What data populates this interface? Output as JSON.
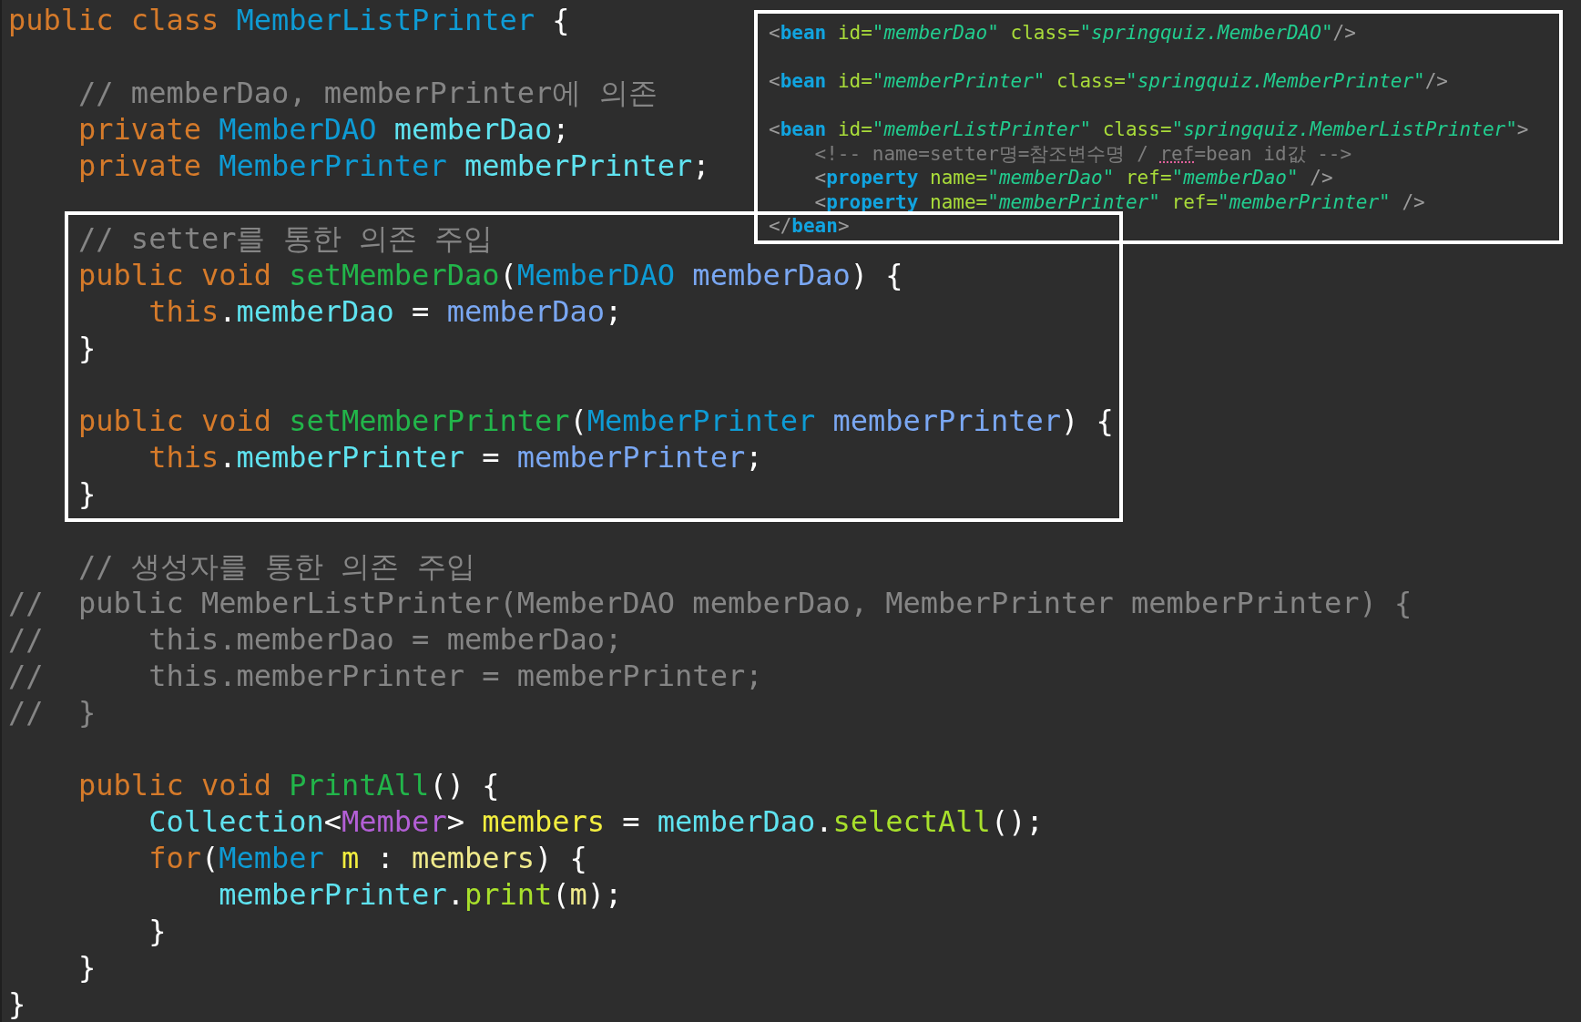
{
  "code_lines": [
    {
      "kind": "code",
      "tokens": [
        {
          "text": "public class ",
          "kind": "keyword"
        },
        {
          "text": "MemberListPrinter",
          "kind": "type"
        },
        {
          "text": " {",
          "kind": "plain"
        }
      ]
    },
    {
      "kind": "blank"
    },
    {
      "kind": "code",
      "tokens": [
        {
          "text": "    // memberDao, memberPrinter에 의존",
          "kind": "comment"
        }
      ]
    },
    {
      "kind": "code",
      "tokens": [
        {
          "text": "    private ",
          "kind": "keyword"
        },
        {
          "text": "MemberDAO ",
          "kind": "type"
        },
        {
          "text": "memberDao",
          "kind": "field"
        },
        {
          "text": ";",
          "kind": "plain"
        }
      ]
    },
    {
      "kind": "code",
      "tokens": [
        {
          "text": "    private ",
          "kind": "keyword"
        },
        {
          "text": "MemberPrinter ",
          "kind": "type"
        },
        {
          "text": "memberPrinter",
          "kind": "field"
        },
        {
          "text": ";",
          "kind": "plain"
        }
      ]
    },
    {
      "kind": "blank"
    },
    {
      "kind": "code",
      "tokens": [
        {
          "text": "    // setter를 통한 의존 주입",
          "kind": "comment"
        }
      ]
    },
    {
      "kind": "code",
      "tokens": [
        {
          "text": "    public void ",
          "kind": "keyword"
        },
        {
          "text": "setMemberDao",
          "kind": "method"
        },
        {
          "text": "(",
          "kind": "plain"
        },
        {
          "text": "MemberDAO ",
          "kind": "type"
        },
        {
          "text": "memberDao",
          "kind": "param"
        },
        {
          "text": ") {",
          "kind": "plain"
        }
      ]
    },
    {
      "kind": "code",
      "tokens": [
        {
          "text": "        this",
          "kind": "keyword"
        },
        {
          "text": ".",
          "kind": "plain"
        },
        {
          "text": "memberDao",
          "kind": "field"
        },
        {
          "text": " = ",
          "kind": "plain"
        },
        {
          "text": "memberDao",
          "kind": "param"
        },
        {
          "text": ";",
          "kind": "plain"
        }
      ]
    },
    {
      "kind": "code",
      "tokens": [
        {
          "text": "    }",
          "kind": "plain"
        }
      ]
    },
    {
      "kind": "blank"
    },
    {
      "kind": "code",
      "tokens": [
        {
          "text": "    public void ",
          "kind": "keyword"
        },
        {
          "text": "setMemberPrinter",
          "kind": "method"
        },
        {
          "text": "(",
          "kind": "plain"
        },
        {
          "text": "MemberPrinter ",
          "kind": "type"
        },
        {
          "text": "memberPrinter",
          "kind": "param"
        },
        {
          "text": ") {",
          "kind": "plain"
        }
      ]
    },
    {
      "kind": "code",
      "tokens": [
        {
          "text": "        this",
          "kind": "keyword"
        },
        {
          "text": ".",
          "kind": "plain"
        },
        {
          "text": "memberPrinter",
          "kind": "field"
        },
        {
          "text": " = ",
          "kind": "plain"
        },
        {
          "text": "memberPrinter",
          "kind": "param"
        },
        {
          "text": ";",
          "kind": "plain"
        }
      ]
    },
    {
      "kind": "code",
      "tokens": [
        {
          "text": "    }",
          "kind": "plain"
        }
      ]
    },
    {
      "kind": "blank"
    },
    {
      "kind": "code",
      "tokens": [
        {
          "text": "    // 생성자를 통한 의존 주입",
          "kind": "comment"
        }
      ]
    },
    {
      "kind": "code",
      "tokens": [
        {
          "text": "//  public MemberListPrinter(MemberDAO memberDao, MemberPrinter memberPrinter) {",
          "kind": "comment"
        }
      ]
    },
    {
      "kind": "code",
      "tokens": [
        {
          "text": "//      this.memberDao = memberDao;",
          "kind": "comment"
        }
      ]
    },
    {
      "kind": "code",
      "tokens": [
        {
          "text": "//      this.memberPrinter = memberPrinter;",
          "kind": "comment"
        }
      ]
    },
    {
      "kind": "code",
      "tokens": [
        {
          "text": "//  }",
          "kind": "comment"
        }
      ]
    },
    {
      "kind": "blank"
    },
    {
      "kind": "code",
      "tokens": [
        {
          "text": "    public void ",
          "kind": "keyword"
        },
        {
          "text": "PrintAll",
          "kind": "method"
        },
        {
          "text": "() {",
          "kind": "plain"
        }
      ]
    },
    {
      "kind": "code",
      "tokens": [
        {
          "text": "        Collection",
          "kind": "field"
        },
        {
          "text": "<",
          "kind": "plain"
        },
        {
          "text": "Member",
          "kind": "generic"
        },
        {
          "text": "> ",
          "kind": "plain"
        },
        {
          "text": "members",
          "kind": "local"
        },
        {
          "text": " = ",
          "kind": "plain"
        },
        {
          "text": "memberDao",
          "kind": "field"
        },
        {
          "text": ".",
          "kind": "plain"
        },
        {
          "text": "selectAll",
          "kind": "call"
        },
        {
          "text": "();",
          "kind": "plain"
        }
      ]
    },
    {
      "kind": "code",
      "tokens": [
        {
          "text": "        for",
          "kind": "keyword"
        },
        {
          "text": "(",
          "kind": "plain"
        },
        {
          "text": "Member ",
          "kind": "type"
        },
        {
          "text": "m",
          "kind": "local"
        },
        {
          "text": " : ",
          "kind": "plain"
        },
        {
          "text": "members",
          "kind": "local_ref"
        },
        {
          "text": ") {",
          "kind": "plain"
        }
      ]
    },
    {
      "kind": "code",
      "tokens": [
        {
          "text": "            memberPrinter",
          "kind": "field"
        },
        {
          "text": ".",
          "kind": "plain"
        },
        {
          "text": "print",
          "kind": "call"
        },
        {
          "text": "(",
          "kind": "plain"
        },
        {
          "text": "m",
          "kind": "local_ref"
        },
        {
          "text": ");",
          "kind": "plain"
        }
      ]
    },
    {
      "kind": "code",
      "tokens": [
        {
          "text": "        }",
          "kind": "plain"
        }
      ]
    },
    {
      "kind": "code",
      "tokens": [
        {
          "text": "    }",
          "kind": "plain"
        }
      ]
    },
    {
      "kind": "code",
      "tokens": [
        {
          "text": "}",
          "kind": "plain"
        }
      ]
    }
  ],
  "xml_panel": {
    "lines": [
      {
        "kind": "code",
        "tokens": [
          {
            "text": "<",
            "kind": "bracket"
          },
          {
            "text": "bean",
            "kind": "tag"
          },
          {
            "text": " id=",
            "kind": "attr"
          },
          {
            "text": "\"memberDao\"",
            "kind": "value"
          },
          {
            "text": " class=",
            "kind": "attr"
          },
          {
            "text": "\"springquiz.MemberDAO\"",
            "kind": "value"
          },
          {
            "text": "/>",
            "kind": "bracket"
          }
        ]
      },
      {
        "kind": "blank"
      },
      {
        "kind": "code",
        "tokens": [
          {
            "text": "<",
            "kind": "bracket"
          },
          {
            "text": "bean",
            "kind": "tag"
          },
          {
            "text": " id=",
            "kind": "attr"
          },
          {
            "text": "\"memberPrinter\"",
            "kind": "value"
          },
          {
            "text": " class=",
            "kind": "attr"
          },
          {
            "text": "\"springquiz.MemberPrinter\"",
            "kind": "value"
          },
          {
            "text": "/>",
            "kind": "bracket"
          }
        ]
      },
      {
        "kind": "blank"
      },
      {
        "kind": "code",
        "tokens": [
          {
            "text": "<",
            "kind": "bracket"
          },
          {
            "text": "bean",
            "kind": "tag"
          },
          {
            "text": " id=",
            "kind": "attr"
          },
          {
            "text": "\"memberListPrinter\"",
            "kind": "value"
          },
          {
            "text": " class=",
            "kind": "attr"
          },
          {
            "text": "\"springquiz.MemberListPrinter\"",
            "kind": "value"
          },
          {
            "text": ">",
            "kind": "bracket"
          }
        ]
      },
      {
        "kind": "code",
        "tokens": [
          {
            "text": "    <!-- name=setter명=참조변수명 / ",
            "kind": "comment"
          },
          {
            "text": "ref",
            "kind": "misspelled"
          },
          {
            "text": "=bean id값 -->",
            "kind": "comment"
          }
        ]
      },
      {
        "kind": "code",
        "tokens": [
          {
            "text": "    <",
            "kind": "bracket"
          },
          {
            "text": "property",
            "kind": "tag"
          },
          {
            "text": " name=",
            "kind": "attr"
          },
          {
            "text": "\"memberDao\"",
            "kind": "value"
          },
          {
            "text": " ref=",
            "kind": "attr"
          },
          {
            "text": "\"memberDao\"",
            "kind": "value"
          },
          {
            "text": " />",
            "kind": "bracket"
          }
        ]
      },
      {
        "kind": "code",
        "tokens": [
          {
            "text": "    <",
            "kind": "bracket"
          },
          {
            "text": "property",
            "kind": "tag"
          },
          {
            "text": " name=",
            "kind": "attr"
          },
          {
            "text": "\"memberPrinter\"",
            "kind": "value"
          },
          {
            "text": " ref=",
            "kind": "attr"
          },
          {
            "text": "\"memberPrinter\"",
            "kind": "value"
          },
          {
            "text": " />",
            "kind": "bracket"
          }
        ]
      },
      {
        "kind": "code",
        "tokens": [
          {
            "text": "</",
            "kind": "bracket"
          },
          {
            "text": "bean",
            "kind": "tag"
          },
          {
            "text": ">",
            "kind": "bracket"
          }
        ]
      }
    ]
  }
}
